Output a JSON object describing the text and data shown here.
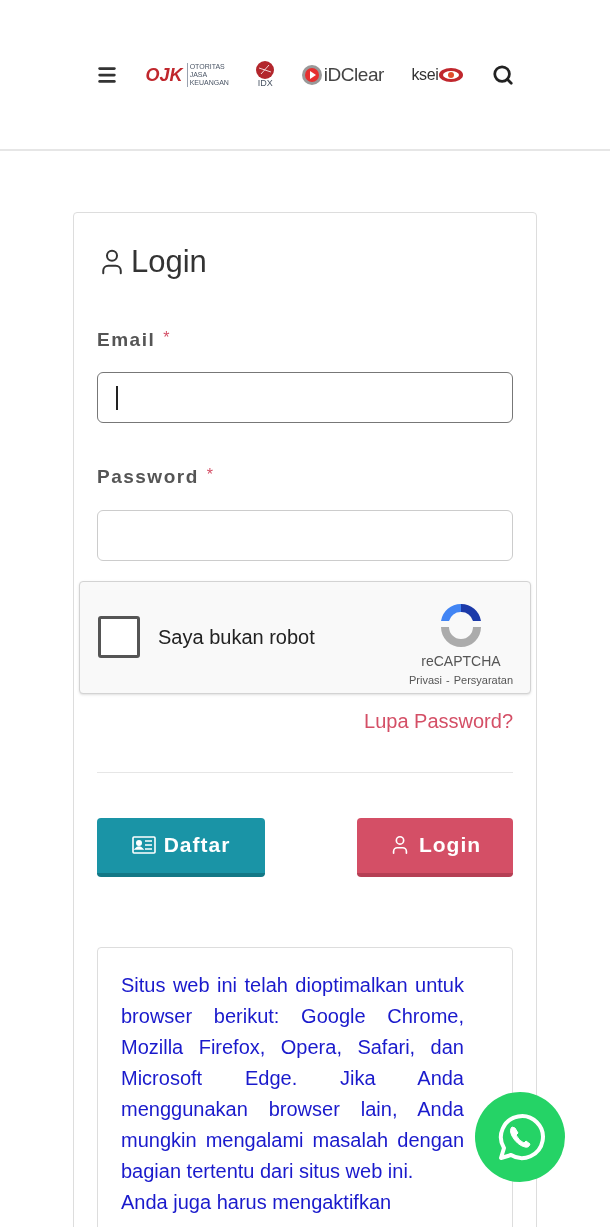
{
  "header": {
    "logos": [
      {
        "kind": "ojk",
        "text": "OJK",
        "subtext": "OTORITAS JASA KEUANGAN"
      },
      {
        "kind": "idx",
        "text": "IDX"
      },
      {
        "kind": "idclear",
        "text": "iDClear"
      },
      {
        "kind": "ksei",
        "text": "ksei"
      }
    ]
  },
  "login": {
    "title": "Login",
    "fields": [
      {
        "label": "Email",
        "required_mark": "*",
        "focused": true
      },
      {
        "label": "Password",
        "required_mark": "*",
        "focused": false
      }
    ],
    "captcha": {
      "label": "Saya bukan robot",
      "checked": false,
      "brand": "reCAPTCHA",
      "links": [
        "Privasi",
        "Persyaratan"
      ],
      "separator": "-"
    },
    "forgot_link": "Lupa Password?",
    "buttons": [
      {
        "kind": "register",
        "label": "Daftar"
      },
      {
        "kind": "login",
        "label": "Login"
      }
    ],
    "notice": [
      "Situs web ini telah dioptimalkan untuk browser berikut: Google Chrome, Mozilla Firefox, Opera, Safari, dan Microsoft Edge. Jika Anda menggunakan browser lain, Anda mungkin mengalami masalah dengan bagian tertentu dari situs web ini.",
      "Anda juga harus mengaktifkan"
    ]
  }
}
